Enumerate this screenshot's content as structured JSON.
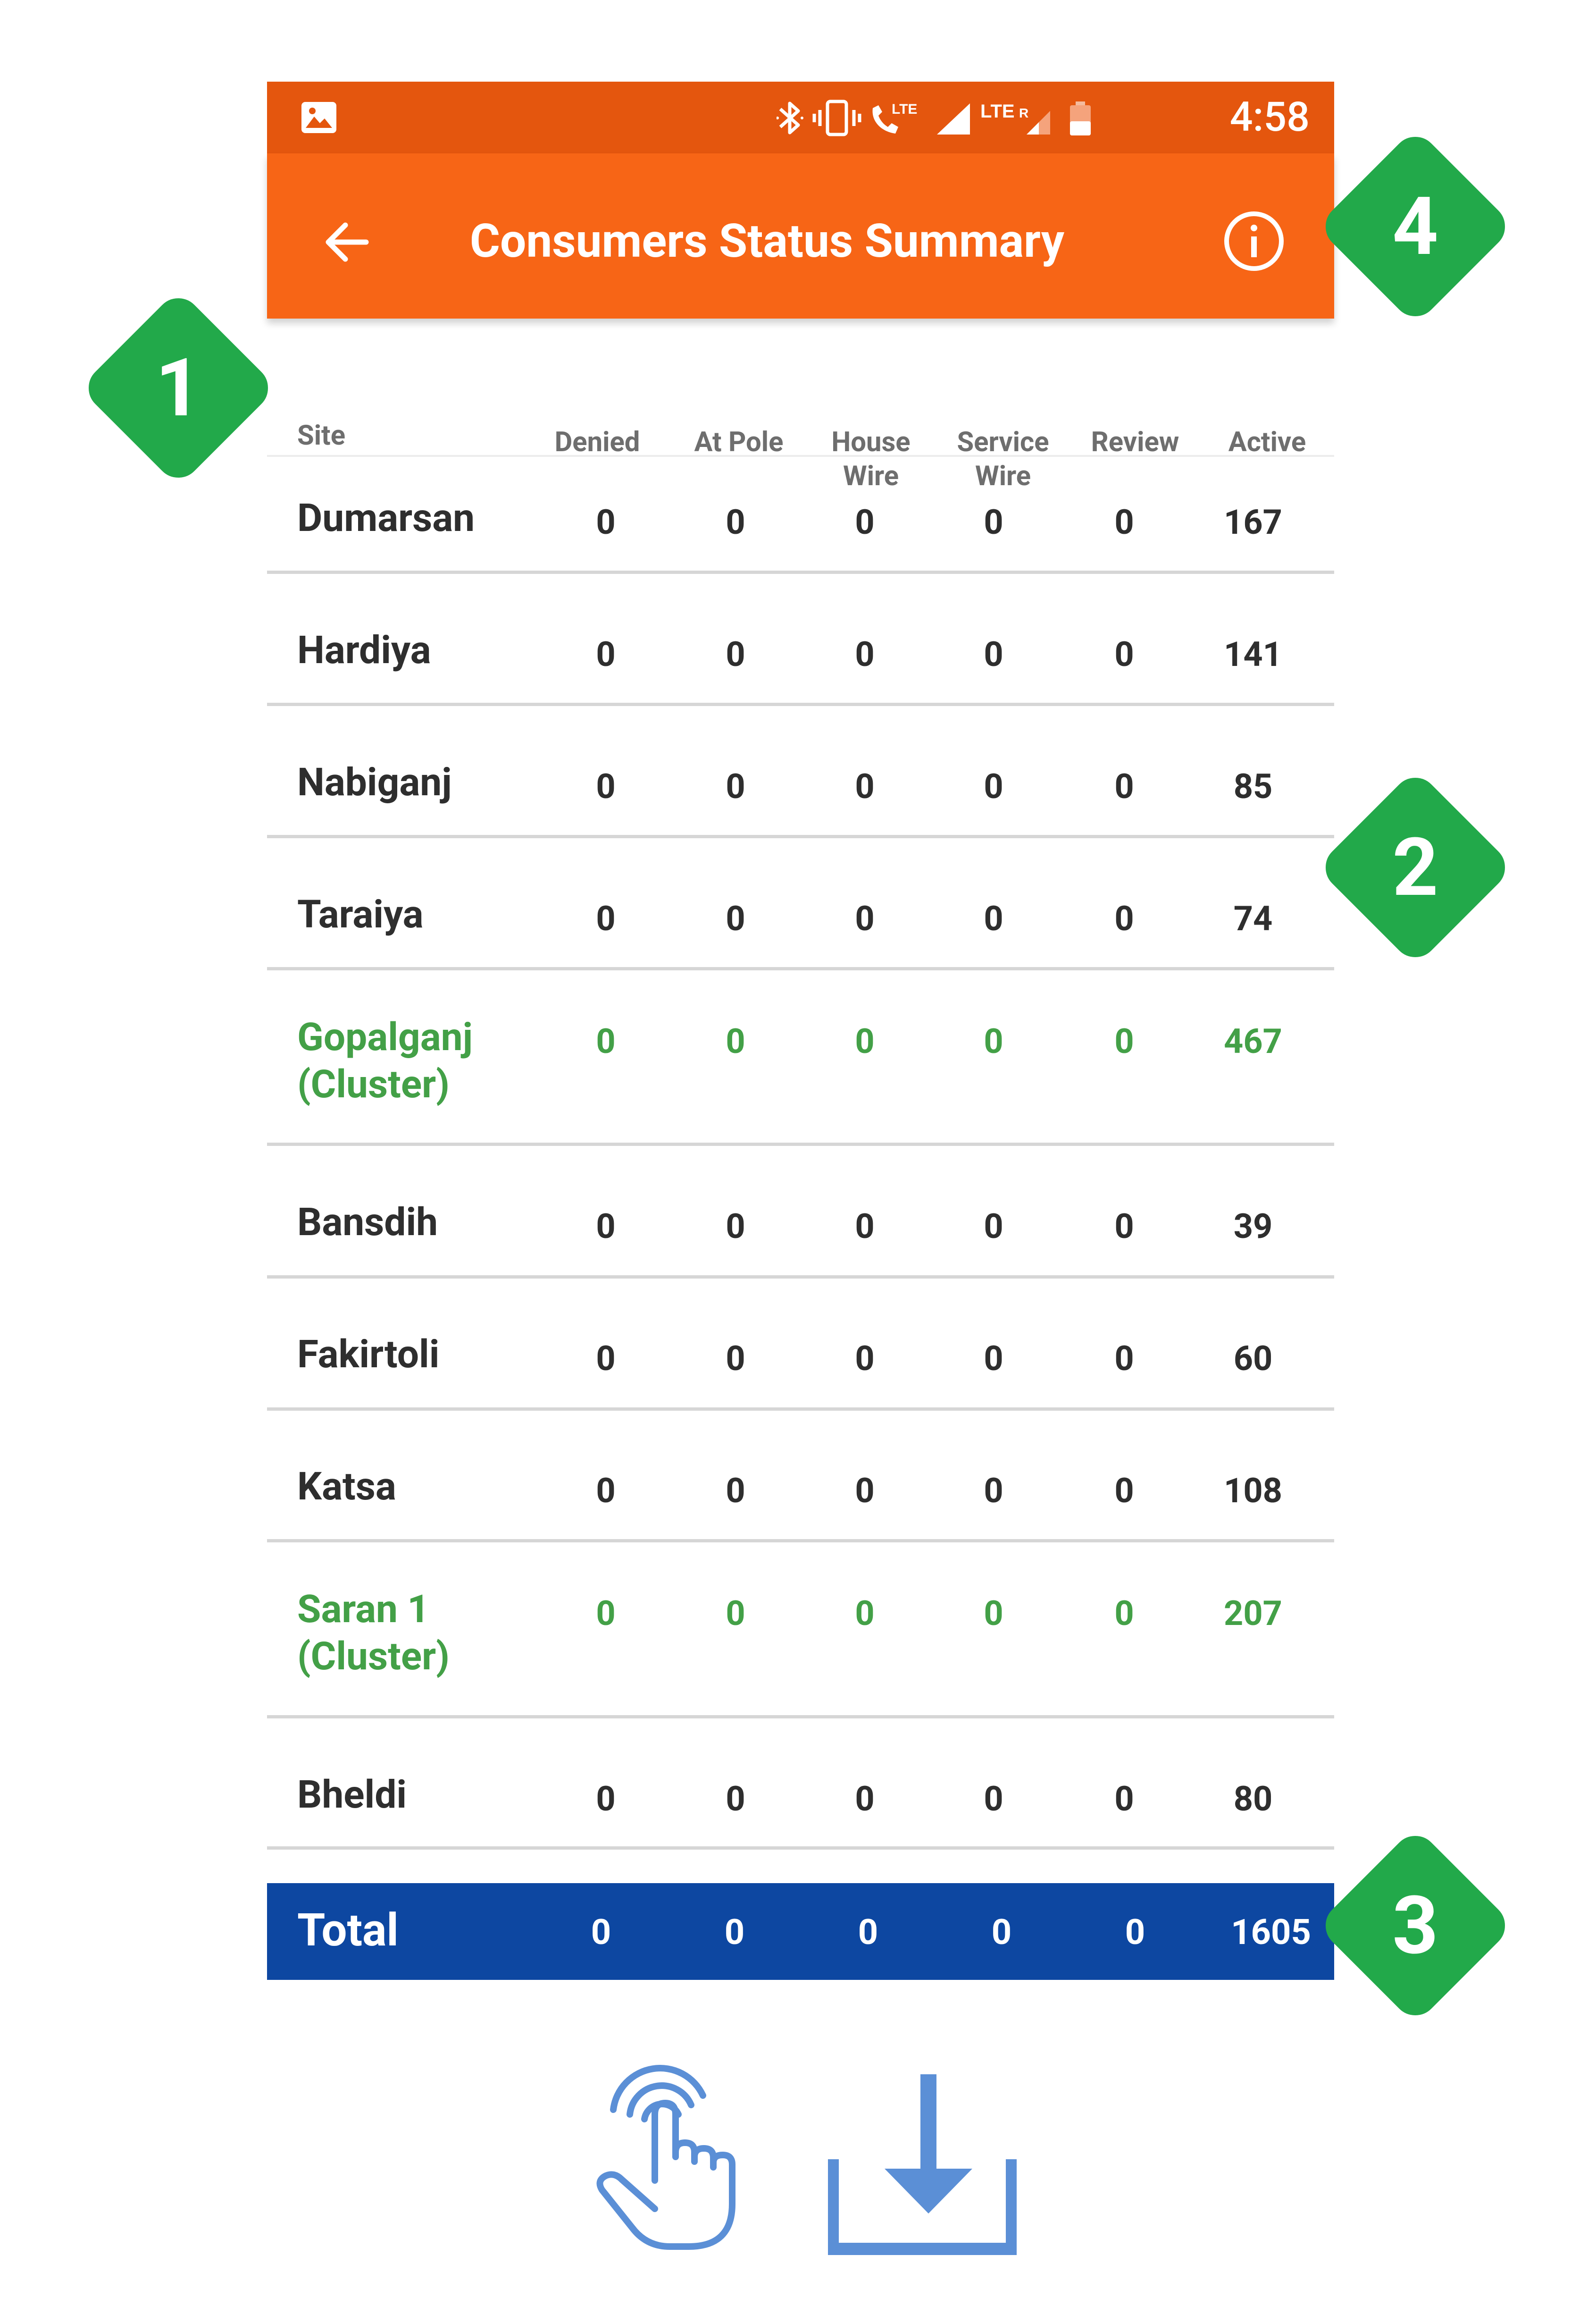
{
  "status_bar": {
    "time": "4:58"
  },
  "app_bar": {
    "title": "Consumers Status Summary"
  },
  "table": {
    "headers": {
      "site": "Site",
      "denied": "Denied",
      "at_pole": "At Pole",
      "house_wire_1": "House",
      "house_wire_2": "Wire",
      "service_wire_1": "Service",
      "service_wire_2": "Wire",
      "review": "Review",
      "active": "Active"
    },
    "rows": [
      {
        "site": "Dumarsan",
        "site2": "",
        "denied": "0",
        "at_pole": "0",
        "house_wire": "0",
        "service_wire": "0",
        "review": "0",
        "active": "167"
      },
      {
        "site": "Hardiya",
        "site2": "",
        "denied": "0",
        "at_pole": "0",
        "house_wire": "0",
        "service_wire": "0",
        "review": "0",
        "active": "141"
      },
      {
        "site": "Nabiganj",
        "site2": "",
        "denied": "0",
        "at_pole": "0",
        "house_wire": "0",
        "service_wire": "0",
        "review": "0",
        "active": "85"
      },
      {
        "site": "Taraiya",
        "site2": "",
        "denied": "0",
        "at_pole": "0",
        "house_wire": "0",
        "service_wire": "0",
        "review": "0",
        "active": "74"
      },
      {
        "site": "Gopalganj",
        "site2": "(Cluster)",
        "denied": "0",
        "at_pole": "0",
        "house_wire": "0",
        "service_wire": "0",
        "review": "0",
        "active": "467"
      },
      {
        "site": "Bansdih",
        "site2": "",
        "denied": "0",
        "at_pole": "0",
        "house_wire": "0",
        "service_wire": "0",
        "review": "0",
        "active": "39"
      },
      {
        "site": "Fakirtoli",
        "site2": "",
        "denied": "0",
        "at_pole": "0",
        "house_wire": "0",
        "service_wire": "0",
        "review": "0",
        "active": "60"
      },
      {
        "site": "Katsa",
        "site2": "",
        "denied": "0",
        "at_pole": "0",
        "house_wire": "0",
        "service_wire": "0",
        "review": "0",
        "active": "108"
      },
      {
        "site": "Saran 1",
        "site2": "(Cluster)",
        "denied": "0",
        "at_pole": "0",
        "house_wire": "0",
        "service_wire": "0",
        "review": "0",
        "active": "207"
      },
      {
        "site": "Bheldi",
        "site2": "",
        "denied": "0",
        "at_pole": "0",
        "house_wire": "0",
        "service_wire": "0",
        "review": "0",
        "active": "80"
      }
    ],
    "total": {
      "site": "Total",
      "denied": "0",
      "at_pole": "0",
      "house_wire": "0",
      "service_wire": "0",
      "review": "0",
      "active": "1605"
    }
  },
  "callouts": {
    "c1": "1",
    "c2": "2",
    "c3": "3",
    "c4": "4"
  },
  "colors": {
    "status_bar": "#e4560e",
    "app_bar": "#f76516",
    "cluster_text": "#43a047",
    "total_bar": "#0d47a1",
    "callout": "#22a94a",
    "gesture_icons": "#5b8fd6"
  },
  "icons": {
    "status_bar": [
      "image-icon",
      "bluetooth-icon",
      "vibrate-icon",
      "volte-call-icon",
      "signal-icon",
      "lte-roaming-signal-icon",
      "battery-icon"
    ],
    "app_bar": [
      "back-arrow-icon",
      "info-icon"
    ],
    "footer": [
      "tap-gesture-icon",
      "download-icon"
    ]
  }
}
